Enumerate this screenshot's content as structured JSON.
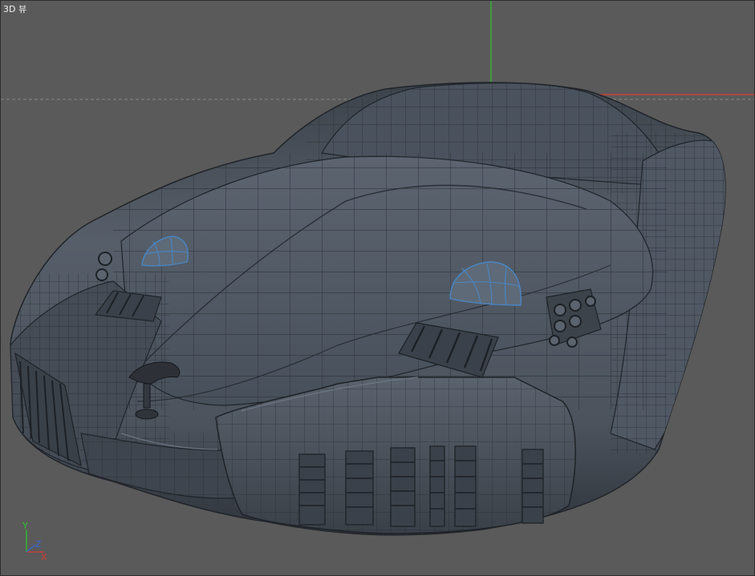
{
  "viewport": {
    "label": "3D 뷰",
    "background_color": "#5a5a5a",
    "border_color": "#2c2c2c"
  },
  "scene": {
    "object": "car-wireframe-mesh",
    "mesh_color": "#4f5763",
    "wire_color": "#23272d",
    "selection_color": "#4a86c4",
    "axis_colors": {
      "x": "#d83b30",
      "y": "#2ec42e",
      "z": "#3a66d8"
    }
  },
  "gizmo": {
    "x_label": "X",
    "y_label": "Y",
    "z_label": "Z"
  }
}
